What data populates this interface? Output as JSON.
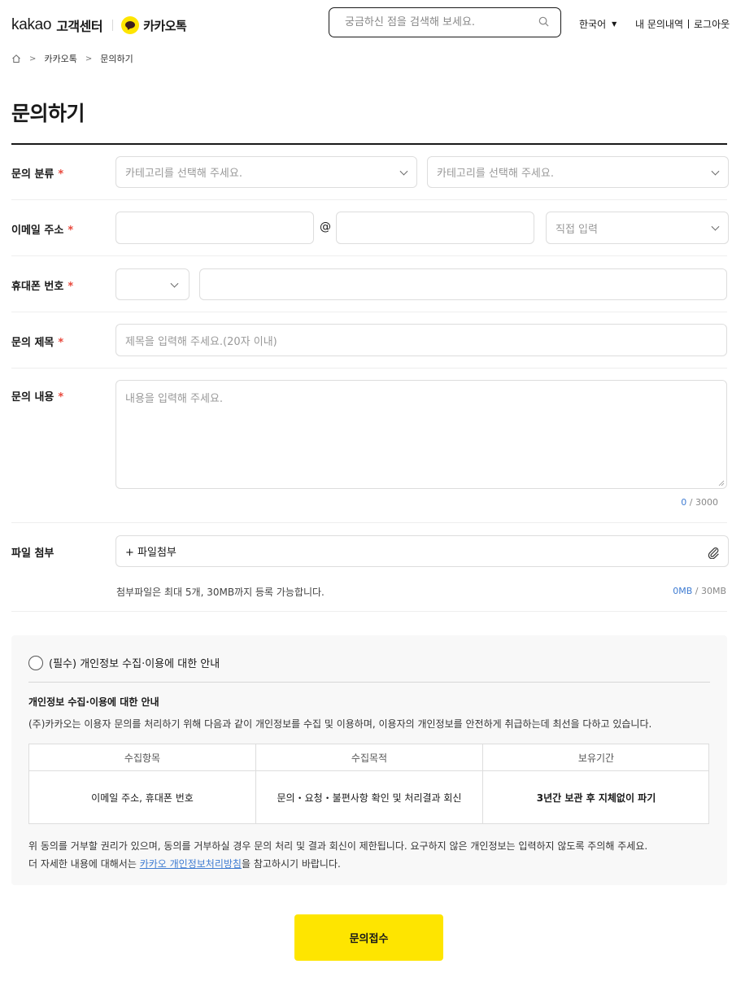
{
  "header": {
    "logo_text": "kakao",
    "logo_suffix": "고객센터",
    "service_name": "카카오톡",
    "search_placeholder": "궁금하신 점을 검색해 보세요.",
    "language": "한국어",
    "my_inquiries": "내 문의내역",
    "logout": "로그아웃"
  },
  "breadcrumb": [
    "카카오톡",
    "문의하기"
  ],
  "page_title": "문의하기",
  "form": {
    "category": {
      "label": "문의 분류",
      "required": "*",
      "select1_placeholder": "카테고리를 선택해 주세요.",
      "select2_placeholder": "카테고리를 선택해 주세요."
    },
    "email": {
      "label": "이메일 주소",
      "required": "*",
      "at": "@",
      "domain_select": "직접 입력"
    },
    "phone": {
      "label": "휴대폰 번호",
      "required": "*"
    },
    "subject": {
      "label": "문의 제목",
      "required": "*",
      "placeholder": "제목을 입력해 주세요.(20자 이내)"
    },
    "content": {
      "label": "문의 내용",
      "required": "*",
      "placeholder": "내용을 입력해 주세요.",
      "count": "0",
      "max": " / 3000"
    },
    "attachment": {
      "label": "파일 첨부",
      "button": "+ 파일첨부",
      "help": "첨부파일은 최대 5개, 30MB까지 등록 가능합니다.",
      "used": "0MB",
      "limit": " / 30MB"
    }
  },
  "privacy": {
    "agree_label": "(필수) 개인정보 수집·이용에 대한 안내",
    "heading": "개인정보 수집·이용에 대한 안내",
    "description": "(주)카카오는 이용자 문의를 처리하기 위해 다음과 같이 개인정보를 수집 및 이용하며, 이용자의 개인정보를 안전하게 취급하는데 최선을 다하고 있습니다.",
    "table": {
      "headers": [
        "수집항목",
        "수집목적",
        "보유기간"
      ],
      "row": [
        "이메일 주소, 휴대폰 번호",
        "문의・요청・불편사항 확인 및 처리결과 회신",
        "3년간 보관 후 지체없이 파기"
      ]
    },
    "footer_line1": "위 동의를 거부할 권리가 있으며, 동의를 거부하실 경우 문의 처리 및 결과 회신이 제한됩니다. 요구하지 않은 개인정보는 입력하지 않도록 주의해 주세요.",
    "footer_line2_prefix": "더 자세한 내용에 대해서는 ",
    "footer_link": "카카오 개인정보처리방침",
    "footer_line2_suffix": "을 참고하시기 바랍니다."
  },
  "submit_label": "문의접수",
  "colors": {
    "accent_yellow": "#fee500",
    "link_blue": "#3f7cd2",
    "required_red": "#e8483c"
  }
}
